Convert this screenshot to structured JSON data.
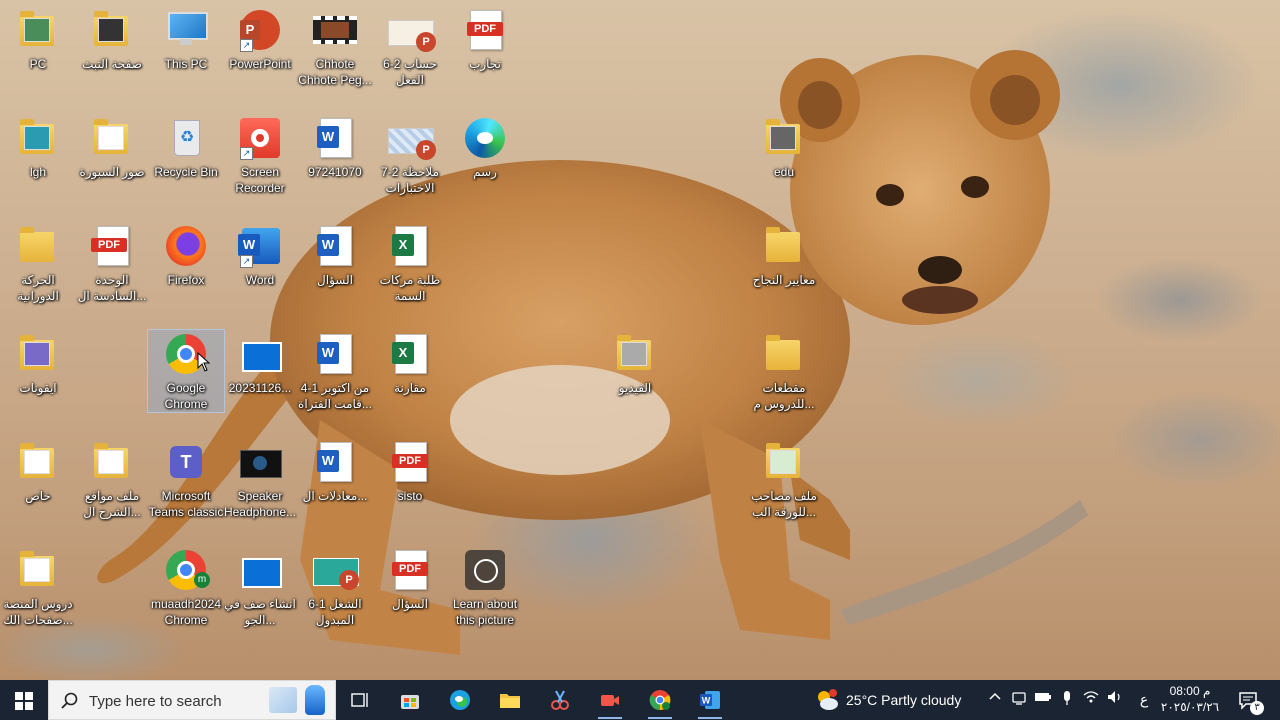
{
  "desktop": {
    "icons": [
      {
        "label": "PC"
      },
      {
        "label": "صفحة التبث"
      },
      {
        "label": "This PC"
      },
      {
        "label": "PowerPoint"
      },
      {
        "label": "Chhote Chhote Peg..."
      },
      {
        "label": "حساب 2-6 الفعل"
      },
      {
        "label": "تجارب"
      },
      {
        "label": "lgh"
      },
      {
        "label": "صور السبورة"
      },
      {
        "label": "Recycle Bin"
      },
      {
        "label": "Screen Recorder"
      },
      {
        "label": "97241070"
      },
      {
        "label": "ملاحظة 2-7 الاختبارات"
      },
      {
        "label": "رسم"
      },
      {
        "label": "edu"
      },
      {
        "label": "الحركة الدورانية"
      },
      {
        "label": "الوحدة السادسة ال..."
      },
      {
        "label": "Firefox"
      },
      {
        "label": "Word"
      },
      {
        "label": "السؤال"
      },
      {
        "label": "طلبة مركات السمة"
      },
      {
        "label": "معايير النجاح"
      },
      {
        "label": "ايقونات"
      },
      {
        "label": "Google Chrome"
      },
      {
        "label": "20231126..."
      },
      {
        "label": "من اكتوبر 1-4 قامت الفتراة..."
      },
      {
        "label": "مقارنة"
      },
      {
        "label": "الفيديو"
      },
      {
        "label": "مقطعات للدروس م..."
      },
      {
        "label": "خاص"
      },
      {
        "label": "ملف مواقع الشرح ال..."
      },
      {
        "label": "Microsoft Teams classic"
      },
      {
        "label": "Speaker Headphone..."
      },
      {
        "label": "معادلات ال..."
      },
      {
        "label": "sisto"
      },
      {
        "label": "ملف مصاحب للورقة الب..."
      },
      {
        "label": "دروس المنصة صفحات الك..."
      },
      {
        "label": "muaadh2024 Chrome"
      },
      {
        "label": "انشاء صف في الجو..."
      },
      {
        "label": "الشغل 1-6 المبدول"
      },
      {
        "label": "السؤال"
      },
      {
        "label": "Learn about this picture"
      }
    ]
  },
  "taskbar": {
    "search_placeholder": "Type here to search",
    "apps": [
      "Task View",
      "Microsoft Store",
      "Microsoft Edge",
      "File Explorer",
      "Snipping Tool",
      "Screen Recorder",
      "Google Chrome",
      "Word"
    ],
    "weather": "25°C  Partly cloudy",
    "lang": "ع",
    "time": "08:00 م",
    "date": "٢٠٢٥/٠٣/٢٦",
    "notification_count": "٣"
  },
  "colors": {
    "taskbar": "#1b2433",
    "accent": "#8fb8e8"
  }
}
